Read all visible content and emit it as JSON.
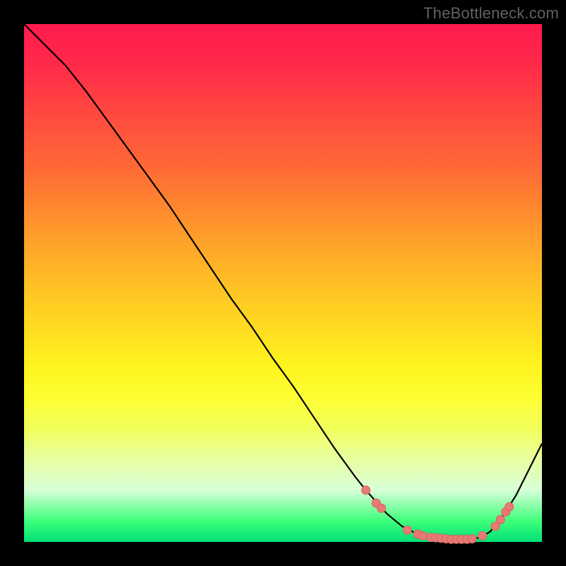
{
  "watermark": "TheBottleneck.com",
  "colors": {
    "frame": "#000000",
    "curve": "#000000",
    "marker": "#e77a74",
    "gradient_top": "#ff1a4d",
    "gradient_bottom": "#00e076"
  },
  "chart_data": {
    "type": "line",
    "title": "",
    "xlabel": "",
    "ylabel": "",
    "xlim": [
      0,
      100
    ],
    "ylim": [
      0,
      100
    ],
    "x": [
      0,
      4,
      8,
      12,
      16,
      20,
      24,
      28,
      32,
      36,
      40,
      44,
      48,
      52,
      56,
      60,
      64,
      66,
      70,
      73,
      75,
      78,
      82,
      85,
      88,
      90,
      92,
      95,
      100
    ],
    "y": [
      100,
      96,
      92,
      87,
      81.5,
      76,
      70.5,
      65,
      59,
      53,
      47,
      41.5,
      35.5,
      30,
      24,
      18,
      12.5,
      10,
      5.5,
      3,
      2,
      1,
      0.5,
      0.5,
      0.8,
      2,
      4.3,
      9,
      19
    ],
    "markers": [
      {
        "x": 66,
        "y": 10
      },
      {
        "x": 68,
        "y": 7.5
      },
      {
        "x": 69,
        "y": 6.5
      },
      {
        "x": 74,
        "y": 2.3
      },
      {
        "x": 76,
        "y": 1.5
      },
      {
        "x": 77,
        "y": 1.2
      },
      {
        "x": 78.5,
        "y": 0.9
      },
      {
        "x": 79.5,
        "y": 0.8
      },
      {
        "x": 80.5,
        "y": 0.7
      },
      {
        "x": 81.5,
        "y": 0.6
      },
      {
        "x": 82.5,
        "y": 0.5
      },
      {
        "x": 83.5,
        "y": 0.5
      },
      {
        "x": 84.5,
        "y": 0.5
      },
      {
        "x": 85.5,
        "y": 0.5
      },
      {
        "x": 86.5,
        "y": 0.6
      },
      {
        "x": 88.5,
        "y": 1.2
      },
      {
        "x": 91,
        "y": 3
      },
      {
        "x": 92,
        "y": 4.3
      },
      {
        "x": 93,
        "y": 5.8
      },
      {
        "x": 93.7,
        "y": 6.8
      }
    ]
  }
}
